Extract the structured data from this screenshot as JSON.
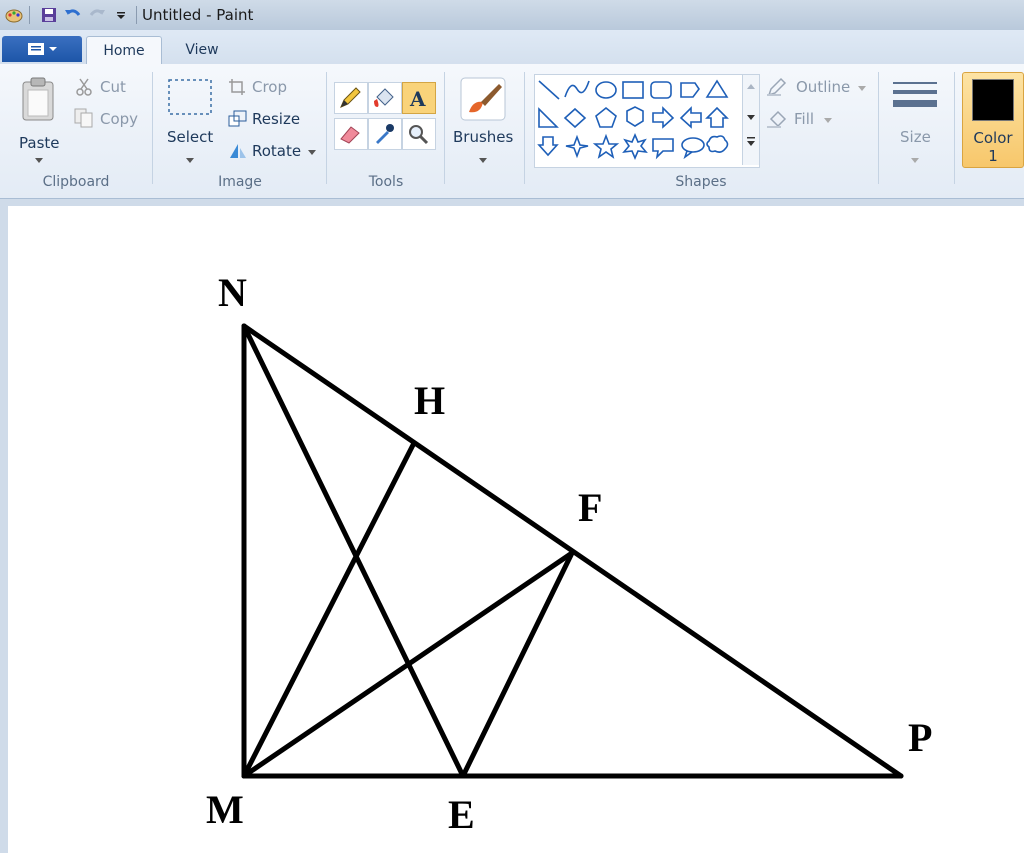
{
  "window": {
    "title": "Untitled - Paint"
  },
  "tabs": [
    {
      "label": "Home"
    },
    {
      "label": "View"
    }
  ],
  "clipboard": {
    "paste": "Paste",
    "cut": "Cut",
    "copy": "Copy",
    "label": "Clipboard"
  },
  "image": {
    "select": "Select",
    "crop": "Crop",
    "resize": "Resize",
    "rotate": "Rotate",
    "label": "Image"
  },
  "tools": {
    "label": "Tools"
  },
  "brushes": {
    "label": "Brushes"
  },
  "shapes": {
    "label": "Shapes",
    "outline": "Outline",
    "fill": "Fill"
  },
  "size": {
    "label": "Size"
  },
  "color1": {
    "label": "Color",
    "index": "1",
    "value": "#000000"
  },
  "drawing": {
    "points": [
      {
        "name": "N"
      },
      {
        "name": "H"
      },
      {
        "name": "F"
      },
      {
        "name": "P"
      },
      {
        "name": "M"
      },
      {
        "name": "E"
      }
    ]
  },
  "colors": {
    "accent": "#f7c76b",
    "ribbon": "#e3ebf5",
    "active_tab": "#f5f8fc"
  }
}
